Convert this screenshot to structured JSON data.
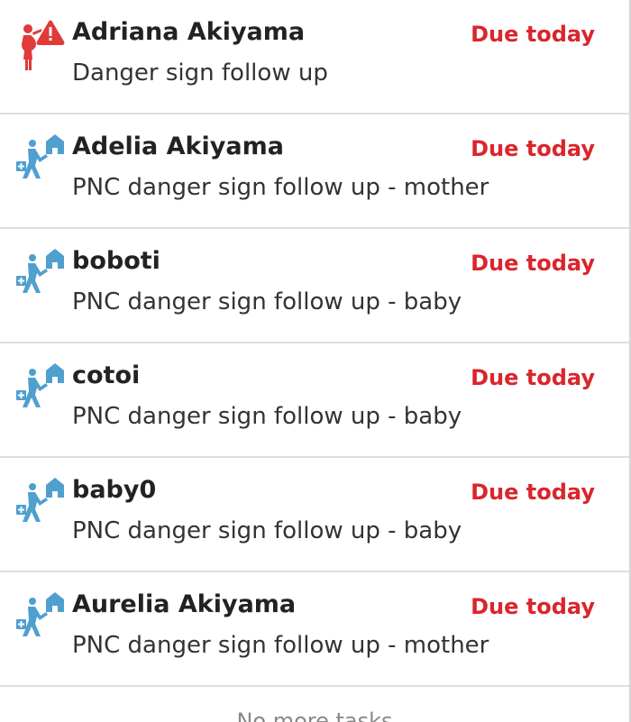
{
  "tasks": [
    {
      "icon": "pregnancy-danger-icon",
      "name": "Adriana Akiyama",
      "due": "Due today",
      "title": "Danger sign follow up"
    },
    {
      "icon": "pnc-home-visit-icon",
      "name": "Adelia Akiyama",
      "due": "Due today",
      "title": "PNC danger sign follow up - mother"
    },
    {
      "icon": "pnc-home-visit-icon",
      "name": "boboti",
      "due": "Due today",
      "title": "PNC danger sign follow up - baby"
    },
    {
      "icon": "pnc-home-visit-icon",
      "name": "cotoi",
      "due": "Due today",
      "title": "PNC danger sign follow up - baby"
    },
    {
      "icon": "pnc-home-visit-icon",
      "name": "baby0",
      "due": "Due today",
      "title": "PNC danger sign follow up - baby"
    },
    {
      "icon": "pnc-home-visit-icon",
      "name": "Aurelia Akiyama",
      "due": "Due today",
      "title": "PNC danger sign follow up - mother"
    }
  ],
  "footer": {
    "no_more_tasks": "No more tasks"
  },
  "colors": {
    "due": "#da252c",
    "pnc_icon": "#4f9fcf",
    "danger_icon": "#e03a3a"
  }
}
